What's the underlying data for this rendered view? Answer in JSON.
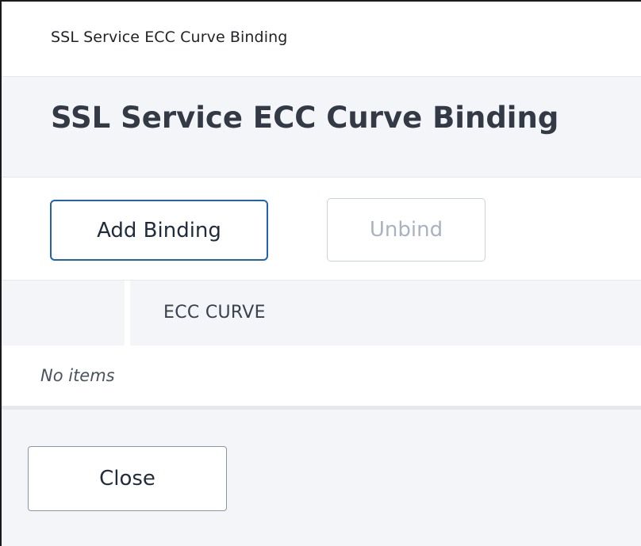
{
  "window": {
    "title": "SSL Service ECC Curve Binding"
  },
  "header": {
    "title": "SSL Service ECC Curve Binding"
  },
  "toolbar": {
    "add_binding_label": "Add Binding",
    "unbind_label": "Unbind"
  },
  "table": {
    "columns": [
      "ECC CURVE"
    ],
    "rows": [],
    "empty_text": "No items"
  },
  "footer": {
    "close_label": "Close"
  },
  "colors": {
    "primary_border": "#1f61b5",
    "disabled_text": "#a9b3c0",
    "panel_background": "#f4f5f8"
  }
}
